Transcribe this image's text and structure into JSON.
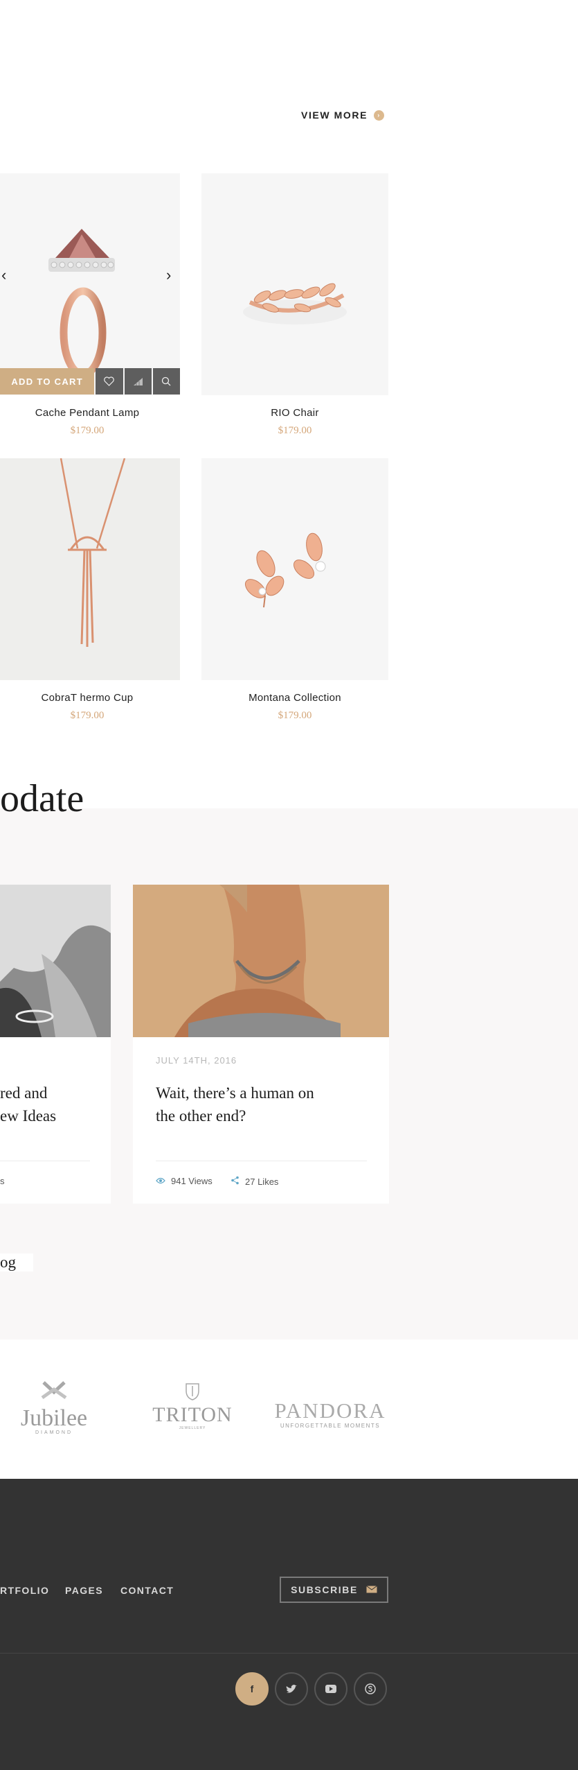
{
  "view_more": {
    "label": "VIEW MORE",
    "icon": "chevron-right-icon"
  },
  "products": [
    {
      "name": "Cache Pendant Lamp",
      "price": "$179.00",
      "image": "ring-icon"
    },
    {
      "name": "RIO Chair",
      "price": "$179.00",
      "image": "leaf-ring-icon"
    },
    {
      "name": "CobraT hermo Cup",
      "price": "$179.00",
      "image": "necklace-icon"
    },
    {
      "name": "Montana Collection",
      "price": "$179.00",
      "image": "earrings-icon"
    }
  ],
  "product_actions": {
    "add_to_cart": "ADD TO CART",
    "icons": [
      "heart-icon",
      "compare-icon",
      "search-icon"
    ],
    "prev": "‹",
    "next": "›"
  },
  "blog": {
    "section_title": "odate",
    "posts": [
      {
        "title_lines": [
          "red and",
          "ew Ideas"
        ],
        "meta": "s"
      },
      {
        "date": "JULY 14TH, 2016",
        "title_lines": [
          "Wait, there’s a human on",
          "the other end?"
        ],
        "views": "941 Views",
        "likes": "27 Likes"
      }
    ],
    "button_label": "og"
  },
  "brands": [
    {
      "name": "Jubilee",
      "tagline": "DIAMOND"
    },
    {
      "name": "TRITON",
      "tagline": "JEWELLERY"
    },
    {
      "name": "PANDORA",
      "tagline": "UNFORGETTABLE MOMENTS"
    }
  ],
  "footer": {
    "nav": [
      "RTFOLIO",
      "PAGES",
      "CONTACT"
    ],
    "subscribe_label": "SUBSCRIBE",
    "social": [
      {
        "icon": "facebook-icon",
        "glyph": "f"
      },
      {
        "icon": "twitter-icon",
        "glyph": "t"
      },
      {
        "icon": "youtube-icon",
        "glyph": "▶"
      },
      {
        "icon": "skype-icon",
        "glyph": "s"
      }
    ]
  },
  "colors": {
    "accent": "#cfae84",
    "price": "#d4a679",
    "footer_bg": "#333333",
    "blog_bg": "#f9f7f7"
  }
}
